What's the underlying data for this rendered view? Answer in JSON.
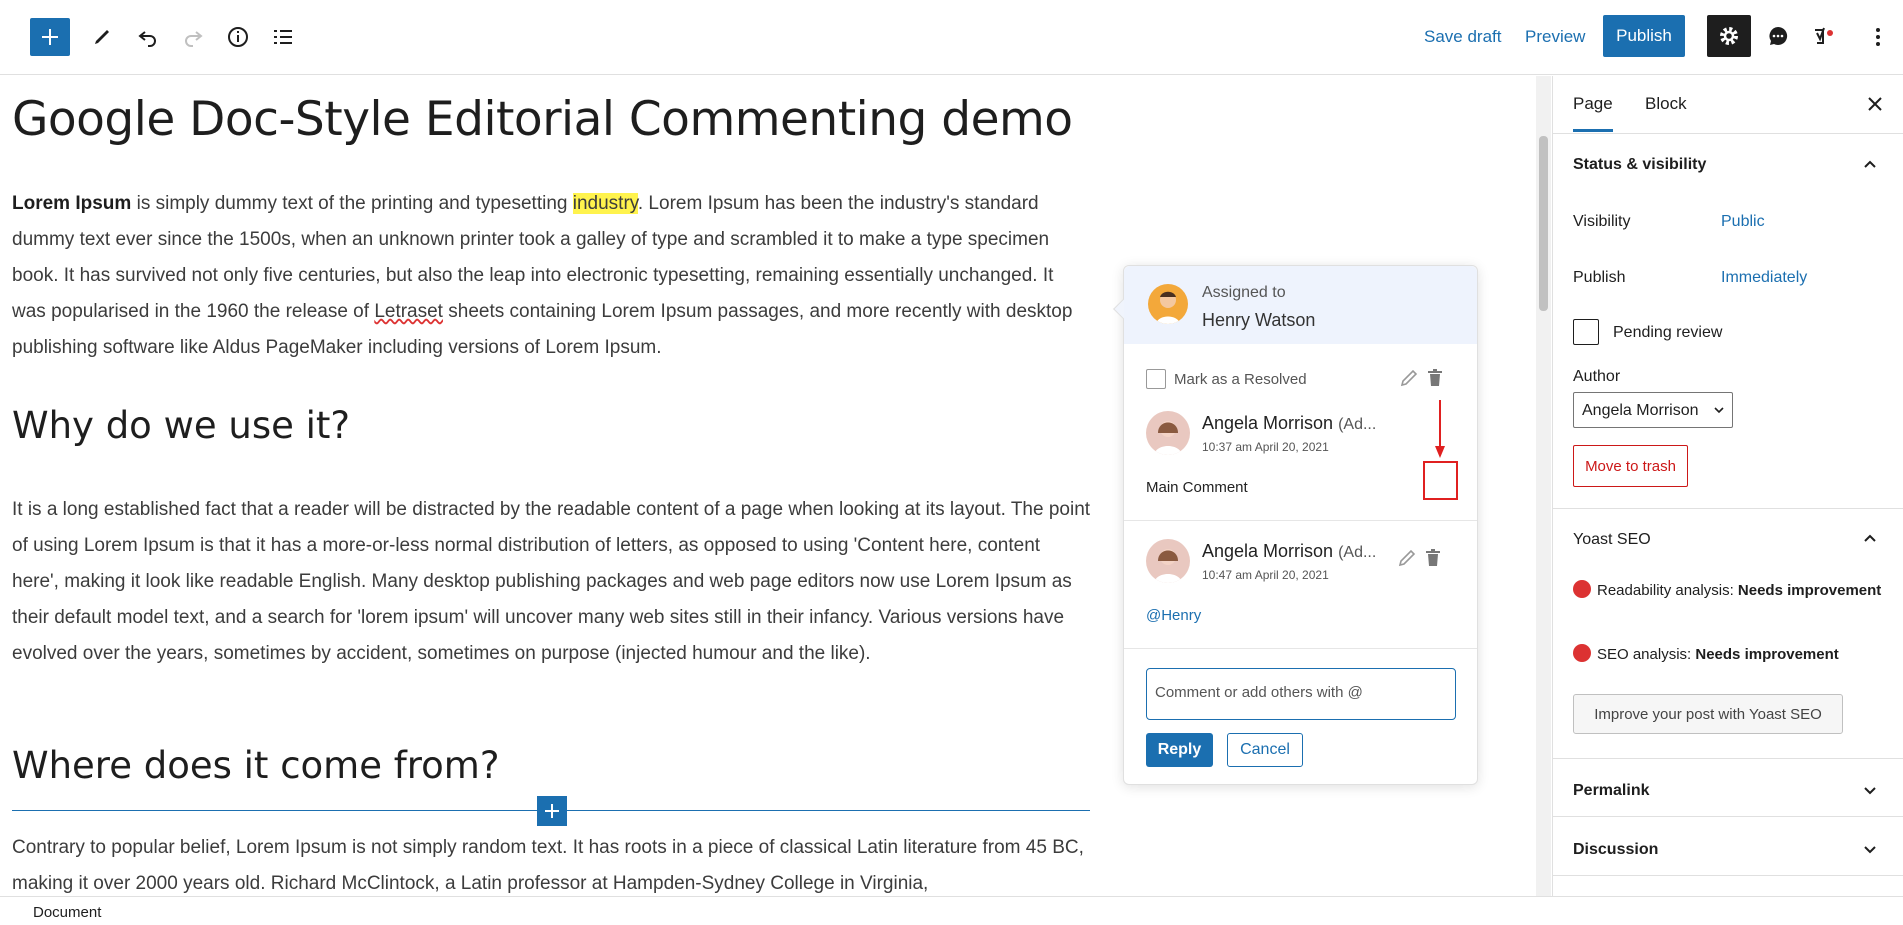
{
  "toolbar": {
    "save_draft": "Save draft",
    "preview": "Preview",
    "publish": "Publish"
  },
  "post": {
    "title": "Google Doc-Style Editorial Commenting demo",
    "p1_bold": "Lorem Ipsum",
    "p1_a": " is simply dummy text of the printing and typesetting ",
    "p1_highlight": "industry",
    "p1_b": ". Lorem Ipsum has been the industry's standard dummy text ever since the 1500s, when an unknown printer took a galley of type and scrambled it to make a type specimen book. It has survived not only five centuries, but also the leap into electronic typesetting, remaining essentially unchanged. It was popularised in the 1960 the release of ",
    "p1_link": "Letraset",
    "p1_c": " sheets containing Lorem Ipsum passages, and more recently with desktop publishing software like Aldus PageMaker including versions of Lorem Ipsum.",
    "h2_1": "Why do we use it?",
    "p2": "It is a long established fact that a reader will be distracted by the readable content of a page when looking at its layout. The point of using Lorem Ipsum is that it has a more-or-less normal distribution of letters, as opposed to using 'Content here, content here', making it look like readable English. Many desktop publishing packages and web page editors now use Lorem Ipsum as their default model text, and a search for 'lorem ipsum' will uncover many web sites still in their infancy. Various versions have evolved over the years, sometimes by accident, sometimes on purpose (injected humour and the like).",
    "h2_2": "Where does it come from?",
    "p3": "Contrary to popular belief, Lorem Ipsum is not simply random text. It has roots in a piece of classical Latin literature from 45 BC, making it over 2000 years old. Richard McClintock, a Latin professor at Hampden-Sydney College in Virginia,"
  },
  "comment_box": {
    "assigned_label": "Assigned to",
    "assigned_name": "Henry Watson",
    "resolve_label": "Mark as a Resolved",
    "comments": [
      {
        "author": "Angela Morrison",
        "role": "(Ad...",
        "time": "10:37 am April 20, 2021",
        "text": "Main Comment"
      },
      {
        "author": "Angela Morrison",
        "role": "(Ad...",
        "time": "10:47 am April 20, 2021",
        "text": "@Henry"
      }
    ],
    "reply_placeholder": "Comment or add others with @",
    "reply_label": "Reply",
    "cancel_label": "Cancel"
  },
  "sidebar": {
    "tab_page": "Page",
    "tab_block": "Block",
    "status_title": "Status & visibility",
    "visibility_label": "Visibility",
    "visibility_value": "Public",
    "publish_label": "Publish",
    "publish_value": "Immediately",
    "pending_label": "Pending review",
    "author_label": "Author",
    "author_value": "Angela Morrison",
    "trash_label": "Move to trash",
    "yoast_title": "Yoast SEO",
    "readability_label": "Readability analysis: ",
    "readability_value": "Needs improvement",
    "seo_label": "SEO analysis: ",
    "seo_value": "Needs improvement",
    "yoast_button": "Improve your post with Yoast SEO",
    "permalink_title": "Permalink",
    "discussion_title": "Discussion"
  },
  "footer": {
    "breadcrumb": "Document"
  },
  "colors": {
    "accent": "#1b6fb0",
    "highlight": "#fff34d",
    "danger": "#cc1818",
    "annotation_red": "#e02020"
  }
}
